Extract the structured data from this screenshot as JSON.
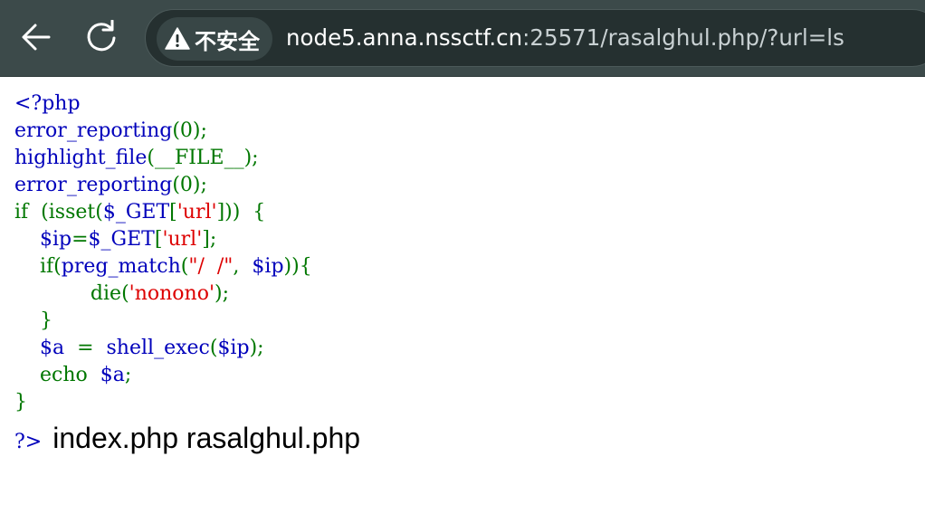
{
  "browser": {
    "back_icon": "arrow-left-icon",
    "reload_icon": "reload-icon",
    "security_icon": "warning-triangle-icon",
    "security_label": "不安全",
    "url_host": "node5.anna.nssctf.cn",
    "url_rest": ":25571/rasalghul.php/?url=ls",
    "colors": {
      "toolbar_bg": "#3c4a4a",
      "omnibox_bg": "#253030"
    }
  },
  "code": {
    "open_tag": "<?php",
    "line2_func": "error_reporting",
    "line2_args": "(0);",
    "line3_func": "highlight_file",
    "line3_args": "(__FILE__);",
    "line4_func": "error_reporting",
    "line4_args": "(0);",
    "line5_if": "if",
    "line5_a": "  (isset(",
    "line5_var": "$_GET",
    "line5_b": "[",
    "line5_str": "'url'",
    "line5_c": "]))  {",
    "line6_indent": "    ",
    "line6_var": "$ip",
    "line6_a": "=",
    "line6_get": "$_GET",
    "line6_b": "[",
    "line6_str": "'url'",
    "line6_c": "];",
    "line7_indent": "    ",
    "line7_if": "if(",
    "line7_func": "preg_match",
    "line7_a": "(",
    "line7_str": "\"/  /\"",
    "line7_b": ",  ",
    "line7_var": "$ip",
    "line7_c": ")){",
    "line8_indent": "            ",
    "line8_func": "die",
    "line8_a": "(",
    "line8_str": "'nonono'",
    "line8_b": ");",
    "line9": "    }",
    "line10_indent": "    ",
    "line10_var": "$a",
    "line10_a": "  =  ",
    "line10_func": "shell_exec",
    "line10_b": "(",
    "line10_arg": "$ip",
    "line10_c": ");",
    "line11_indent": "    ",
    "line11_echo": "echo",
    "line11_a": "  ",
    "line11_var": "$a",
    "line11_b": ";",
    "line12": "}",
    "close_tag": "?>",
    "command_output": "index.php rasalghul.php"
  }
}
